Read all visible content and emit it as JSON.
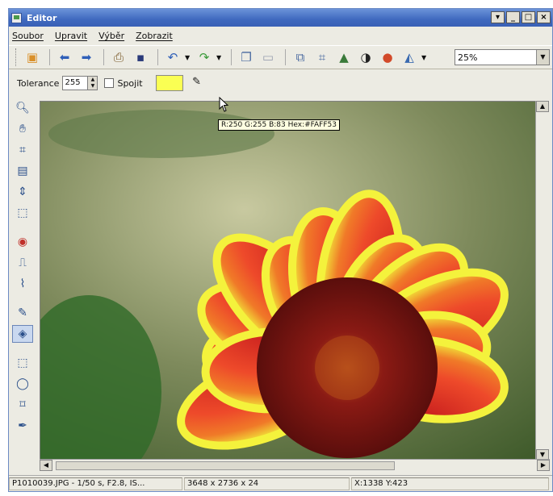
{
  "window": {
    "title": "Editor",
    "controls": [
      "▾",
      "_",
      "□",
      "×"
    ]
  },
  "menu": {
    "items": [
      "Soubor",
      "Upravit",
      "Výběr",
      "Zobrazit"
    ]
  },
  "toolbar": {
    "icons": [
      "open-icon",
      "back-arrow-icon",
      "forward-arrow-icon",
      "scanner-icon",
      "save-icon",
      "undo-icon",
      "redo-icon",
      "copy-icon",
      "paste-icon",
      "resize-icon",
      "crop-icon",
      "image-adjust-icon",
      "contrast-icon",
      "color-balance-icon",
      "effects-icon"
    ],
    "zoom": {
      "value": "25%",
      "options_visible": false
    }
  },
  "options": {
    "tolerance_label": "Tolerance",
    "tolerance_value": "255",
    "connect_label": "Spojit",
    "connect_checked": false,
    "swatch_color": "#FAFF53"
  },
  "tooltip": {
    "text": "R:250 G:255 B:83 Hex:#FAFF53"
  },
  "tools": [
    "zoom-tool-icon",
    "hand-tool-icon",
    "crop-tool-icon",
    "straighten-tool-icon",
    "vertical-line-tool-icon",
    "select-tool-icon",
    "red-eye-tool-icon",
    "clone-tool-icon",
    "smudge-tool-icon",
    "brush-tool-icon",
    "fill-tool-icon",
    "rect-select-tool-icon",
    "lasso-tool-icon",
    "magic-select-tool-icon",
    "dropper-tool-icon"
  ],
  "status": {
    "file": "P1010039.JPG - 1/50 s, F2.8, IS...",
    "dimensions": "3648 x 2736 x 24",
    "coords": "X:1338 Y:423"
  },
  "colors": {
    "petal_red": "#e83a2a",
    "petal_yellow": "#eef23a",
    "center": "#8a1a14"
  }
}
